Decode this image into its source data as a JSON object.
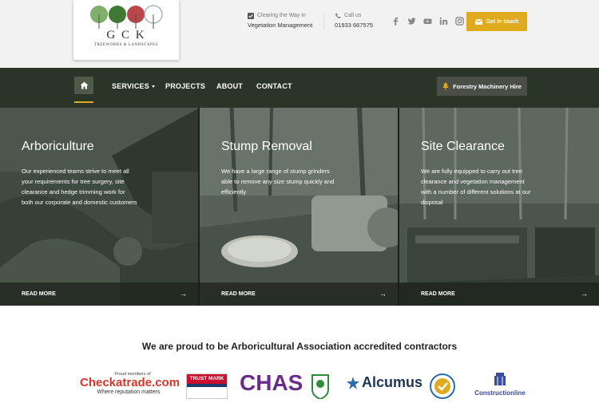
{
  "logo": {
    "text": "G  C  K",
    "sub": "TREEWORKS & LANDSCAPES"
  },
  "header": {
    "clearing_label": "Clearing the Way in",
    "clearing_value": "Vegetation Management",
    "call_label": "Call us",
    "call_value": "01933 667575",
    "cta_label": "Get in touch",
    "social_icons": [
      "facebook-icon",
      "twitter-icon",
      "youtube-icon",
      "linkedin-icon",
      "instagram-icon"
    ]
  },
  "nav": {
    "items": [
      "SERVICES",
      "PROJECTS",
      "ABOUT",
      "CONTACT"
    ],
    "forestry_label": "Forestry Machinery Hire"
  },
  "panels": [
    {
      "title": "Arboriculture",
      "text": "Our experienced teams strive to meet all your requirements for tree surgery, site clearance and hedge trimming work for both our corporate and domestic customers",
      "cta": "READ MORE"
    },
    {
      "title": "Stump Removal",
      "text": "We have a large range of stump grinders able to remove any size stump quickly and efficiently",
      "cta": "READ MORE"
    },
    {
      "title": "Site Clearance",
      "text": "We are fully equipped to carry out tree clearance and vegetation management with a number of different solutions at our disposal",
      "cta": "READ MORE"
    }
  ],
  "accreditation": {
    "title": "We are proud to be Arboricultural Association accredited contractors",
    "checkatrade_small": "Proud members of",
    "checkatrade_name": "Checkatrade.com",
    "checkatrade_tag": "Where reputation matters",
    "trustmark": "TRUST MARK",
    "chas": "CHAS",
    "alcumus": "Alcumus",
    "constructionline": "Constructionline"
  },
  "colors": {
    "accent": "#e0aa1f",
    "nav": "#2b3527",
    "topbar": "#f2f2f2"
  }
}
